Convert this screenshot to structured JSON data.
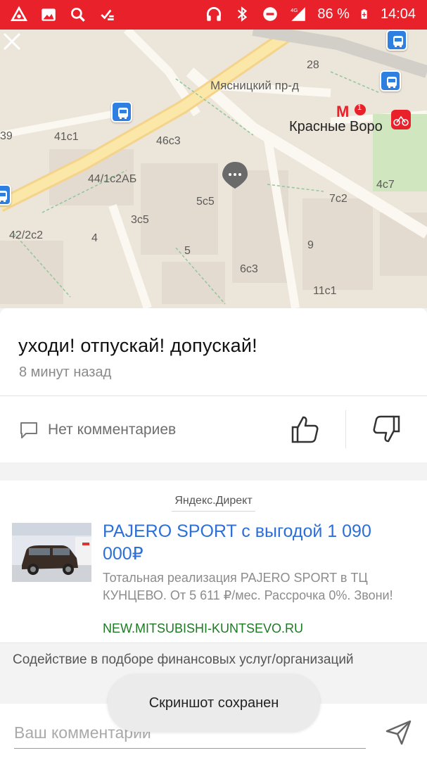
{
  "status_bar": {
    "battery": "86 %",
    "time": "14:04",
    "network": "4G",
    "icons": [
      "assistant-icon",
      "image-icon",
      "search-icon",
      "checklist-icon",
      "headphones-icon",
      "bluetooth-icon",
      "do-not-disturb-icon",
      "signal-icon",
      "battery-icon"
    ]
  },
  "map": {
    "labels": {
      "street": "Мясницкий пр-д",
      "metro": "Красные Воро",
      "metro_line": "1",
      "h28": "28",
      "h39": "39",
      "h41c1": "41с1",
      "h46c3": "46с3",
      "h44": "44/1с2АБ",
      "h5c5": "5с5",
      "h7c2": "7с2",
      "h4c7": "4с7",
      "h3c5": "3с5",
      "h42": "42/2с2",
      "h4": "4",
      "h5": "5",
      "h9": "9",
      "h6c3": "6с3",
      "h11c1": "11с1"
    }
  },
  "post": {
    "title": "уходи! отпускай! допускай!",
    "time_ago": "8 минут назад"
  },
  "actions": {
    "comments_label": "Нет комментариев"
  },
  "ad": {
    "provider": "Яндекс.Директ",
    "title": "PAJERO SPORT с выгодой 1 090 000₽",
    "description": "Тотальная реализация PAJERO SPORT в ТЦ КУНЦЕВО. От 5 611 ₽/мес. Рассрочка 0%. Звони!",
    "url": "NEW.MITSUBISHI-KUNTSEVO.RU",
    "disclaimer": "Содействие в подборе финансовых услуг/организаций"
  },
  "comment_input": {
    "placeholder": "Ваш комментарий"
  },
  "toast": {
    "text": "Скриншот сохранен"
  },
  "colors": {
    "status_bar": "#e8212b",
    "link_blue": "#2d6fd8",
    "url_green": "#1c7a22",
    "bus_stop": "#2f7fe0"
  }
}
